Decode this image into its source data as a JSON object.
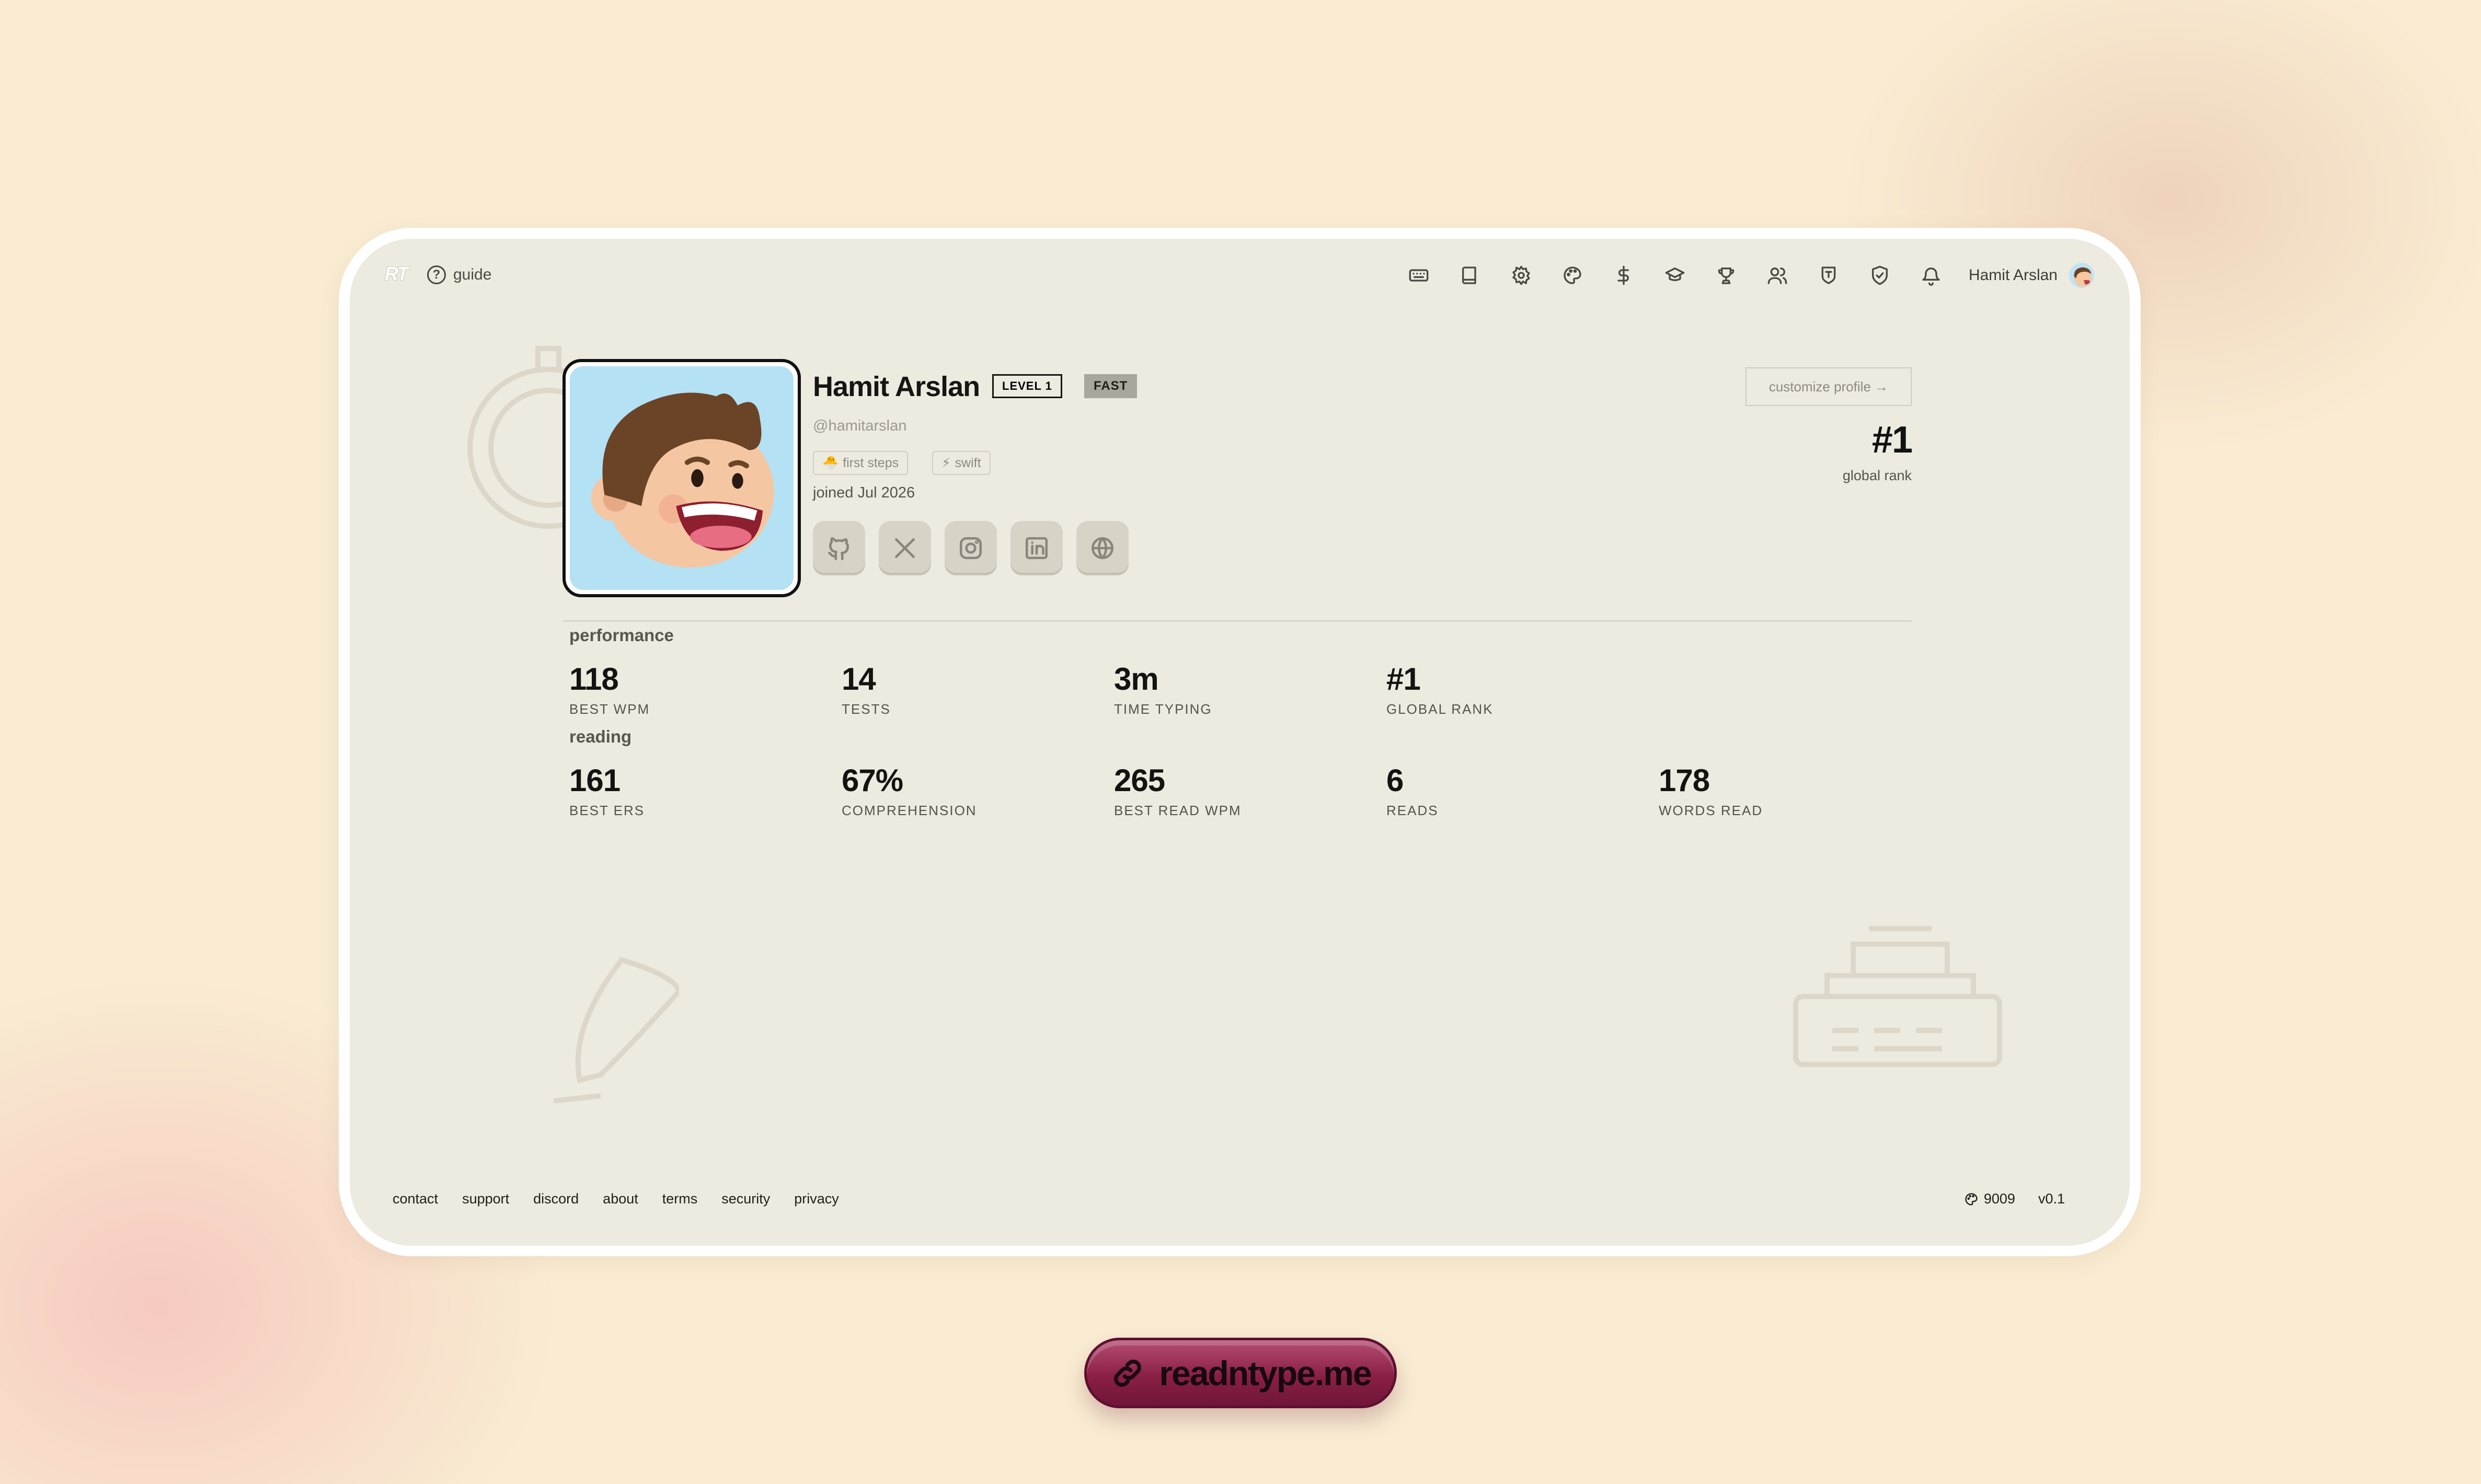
{
  "header": {
    "logo": "RT",
    "guide_label": "guide",
    "nav_icons": [
      "keyboard-icon",
      "book-icon",
      "gear-icon",
      "palette-icon",
      "dollar-icon",
      "graduation-cap-icon",
      "trophy-icon",
      "users-icon",
      "shield-badge-icon",
      "shield-check-icon",
      "bell-icon"
    ],
    "user_name": "Hamit Arslan"
  },
  "profile": {
    "name": "Hamit Arslan",
    "level_badge": "LEVEL 1",
    "speed_badge": "FAST",
    "handle": "@hamitarslan",
    "tags": [
      {
        "icon": "🐣",
        "label": "first steps"
      },
      {
        "icon": "⚡",
        "label": "swift"
      }
    ],
    "joined": "joined Jul 2026",
    "socials": [
      "github-icon",
      "x-icon",
      "instagram-icon",
      "linkedin-icon",
      "globe-icon"
    ],
    "customize_label": "customize profile →",
    "global_rank": "#1",
    "global_rank_label": "global rank"
  },
  "performance": {
    "title": "performance",
    "stats": [
      {
        "value": "118",
        "label": "BEST WPM"
      },
      {
        "value": "14",
        "label": "TESTS"
      },
      {
        "value": "3m",
        "label": "TIME TYPING"
      },
      {
        "value": "#1",
        "label": "GLOBAL RANK"
      }
    ]
  },
  "reading": {
    "title": "reading",
    "stats": [
      {
        "value": "161",
        "label": "BEST ERS"
      },
      {
        "value": "67%",
        "label": "COMPREHENSION"
      },
      {
        "value": "265",
        "label": "BEST READ WPM"
      },
      {
        "value": "6",
        "label": "READS"
      },
      {
        "value": "178",
        "label": "WORDS READ"
      }
    ]
  },
  "footer": {
    "links": [
      "contact",
      "support",
      "discord",
      "about",
      "terms",
      "security",
      "privacy"
    ],
    "theme_count": "9009",
    "version": "v0.1"
  },
  "url_pill": "readntype.me"
}
